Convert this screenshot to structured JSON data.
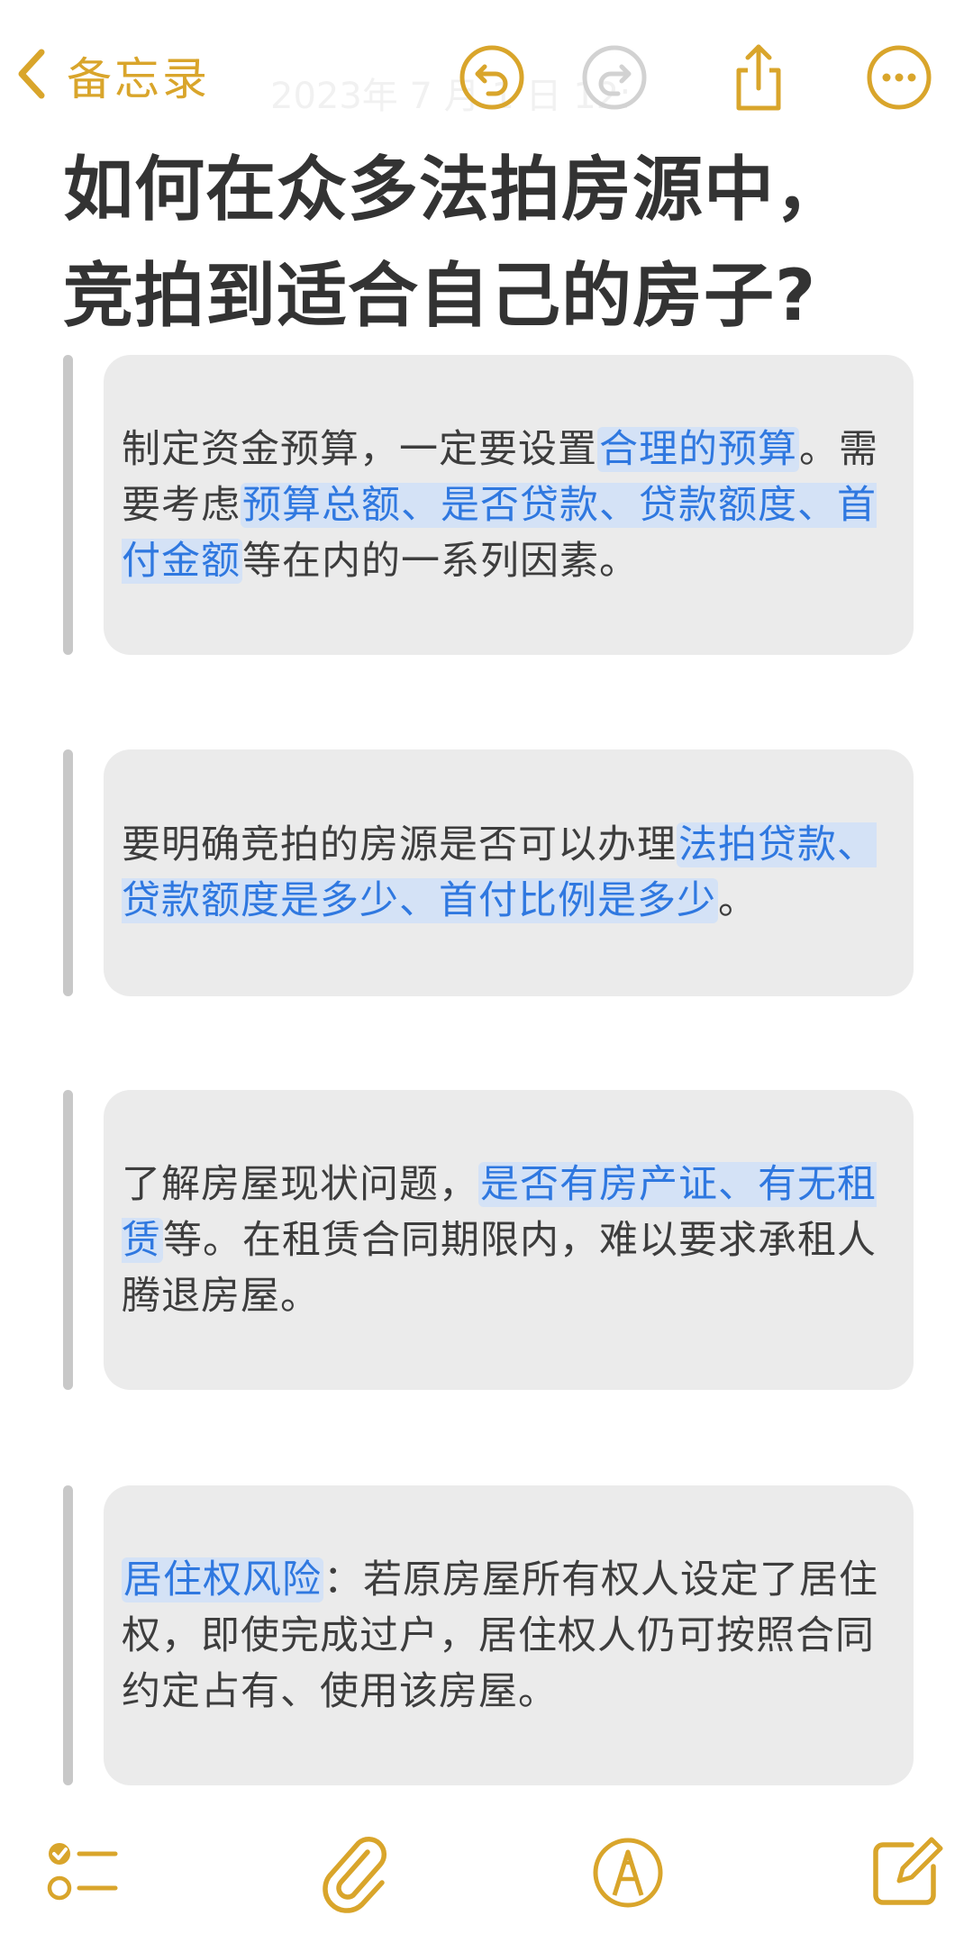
{
  "nav": {
    "back_label": "备忘录",
    "faint_date": "2023年 7 月 1 日 12:",
    "icons": [
      "chevron-left-icon",
      "undo-icon",
      "redo-icon",
      "share-icon",
      "more-icon"
    ]
  },
  "note": {
    "title": "如何在众多法拍房源中，\n竞拍到适合自己的房子?",
    "quotes": [
      {
        "parts": [
          {
            "text": "制定资金预算，一定要设置"
          },
          {
            "text": "合理的预算",
            "hl": true
          },
          {
            "text": "。需要考虑"
          },
          {
            "text": "预算总额、是否贷款、贷款额度、首付金额",
            "hl": true
          },
          {
            "text": "等在内的一系列因素。"
          }
        ]
      },
      {
        "parts": [
          {
            "text": "要明确竞拍的房源是否可以办理"
          },
          {
            "text": "法拍贷款、贷款额度是多少、首付比例是多少",
            "hl": true
          },
          {
            "text": "。"
          }
        ]
      },
      {
        "parts": [
          {
            "text": "了解房屋现状问题，"
          },
          {
            "text": "是否有房产证、有无租赁",
            "hl": true
          },
          {
            "text": "等。在租赁合同期限内，难以要求承租人腾退房屋。"
          }
        ]
      },
      {
        "parts": [
          {
            "text": "居住权风险",
            "hl": true
          },
          {
            "text": "：若原房屋所有权人设定了居住权，即使完成过户，居住权人仍可按照合同约定占有、使用该房屋。"
          }
        ]
      }
    ]
  },
  "toolbar": {
    "icons": [
      "checklist-icon",
      "paperclip-icon",
      "markup-pen-icon",
      "compose-icon"
    ]
  },
  "colors": {
    "accent": "#d9a52b",
    "accent_disabled": "#d2d2d2",
    "highlight_text": "#2f78e0",
    "highlight_bg": "#d4e2f6",
    "quote_bg": "#ebebeb",
    "quote_bar": "#c8c8c8"
  }
}
